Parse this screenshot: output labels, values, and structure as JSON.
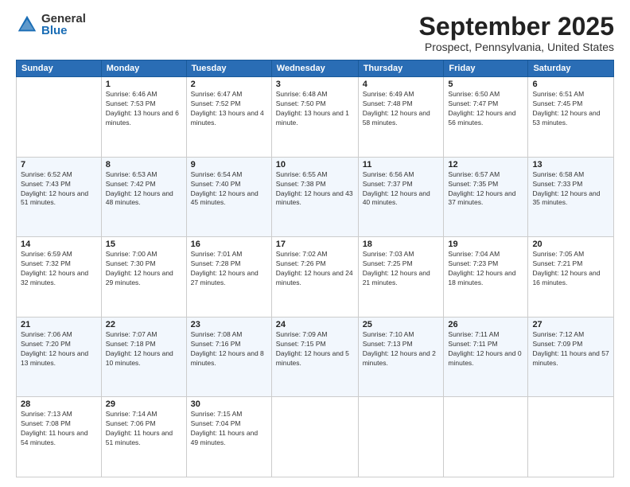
{
  "logo": {
    "general": "General",
    "blue": "Blue"
  },
  "title": "September 2025",
  "subtitle": "Prospect, Pennsylvania, United States",
  "days_header": [
    "Sunday",
    "Monday",
    "Tuesday",
    "Wednesday",
    "Thursday",
    "Friday",
    "Saturday"
  ],
  "weeks": [
    [
      {
        "day": "",
        "sunrise": "",
        "sunset": "",
        "daylight": ""
      },
      {
        "day": "1",
        "sunrise": "Sunrise: 6:46 AM",
        "sunset": "Sunset: 7:53 PM",
        "daylight": "Daylight: 13 hours and 6 minutes."
      },
      {
        "day": "2",
        "sunrise": "Sunrise: 6:47 AM",
        "sunset": "Sunset: 7:52 PM",
        "daylight": "Daylight: 13 hours and 4 minutes."
      },
      {
        "day": "3",
        "sunrise": "Sunrise: 6:48 AM",
        "sunset": "Sunset: 7:50 PM",
        "daylight": "Daylight: 13 hours and 1 minute."
      },
      {
        "day": "4",
        "sunrise": "Sunrise: 6:49 AM",
        "sunset": "Sunset: 7:48 PM",
        "daylight": "Daylight: 12 hours and 58 minutes."
      },
      {
        "day": "5",
        "sunrise": "Sunrise: 6:50 AM",
        "sunset": "Sunset: 7:47 PM",
        "daylight": "Daylight: 12 hours and 56 minutes."
      },
      {
        "day": "6",
        "sunrise": "Sunrise: 6:51 AM",
        "sunset": "Sunset: 7:45 PM",
        "daylight": "Daylight: 12 hours and 53 minutes."
      }
    ],
    [
      {
        "day": "7",
        "sunrise": "Sunrise: 6:52 AM",
        "sunset": "Sunset: 7:43 PM",
        "daylight": "Daylight: 12 hours and 51 minutes."
      },
      {
        "day": "8",
        "sunrise": "Sunrise: 6:53 AM",
        "sunset": "Sunset: 7:42 PM",
        "daylight": "Daylight: 12 hours and 48 minutes."
      },
      {
        "day": "9",
        "sunrise": "Sunrise: 6:54 AM",
        "sunset": "Sunset: 7:40 PM",
        "daylight": "Daylight: 12 hours and 45 minutes."
      },
      {
        "day": "10",
        "sunrise": "Sunrise: 6:55 AM",
        "sunset": "Sunset: 7:38 PM",
        "daylight": "Daylight: 12 hours and 43 minutes."
      },
      {
        "day": "11",
        "sunrise": "Sunrise: 6:56 AM",
        "sunset": "Sunset: 7:37 PM",
        "daylight": "Daylight: 12 hours and 40 minutes."
      },
      {
        "day": "12",
        "sunrise": "Sunrise: 6:57 AM",
        "sunset": "Sunset: 7:35 PM",
        "daylight": "Daylight: 12 hours and 37 minutes."
      },
      {
        "day": "13",
        "sunrise": "Sunrise: 6:58 AM",
        "sunset": "Sunset: 7:33 PM",
        "daylight": "Daylight: 12 hours and 35 minutes."
      }
    ],
    [
      {
        "day": "14",
        "sunrise": "Sunrise: 6:59 AM",
        "sunset": "Sunset: 7:32 PM",
        "daylight": "Daylight: 12 hours and 32 minutes."
      },
      {
        "day": "15",
        "sunrise": "Sunrise: 7:00 AM",
        "sunset": "Sunset: 7:30 PM",
        "daylight": "Daylight: 12 hours and 29 minutes."
      },
      {
        "day": "16",
        "sunrise": "Sunrise: 7:01 AM",
        "sunset": "Sunset: 7:28 PM",
        "daylight": "Daylight: 12 hours and 27 minutes."
      },
      {
        "day": "17",
        "sunrise": "Sunrise: 7:02 AM",
        "sunset": "Sunset: 7:26 PM",
        "daylight": "Daylight: 12 hours and 24 minutes."
      },
      {
        "day": "18",
        "sunrise": "Sunrise: 7:03 AM",
        "sunset": "Sunset: 7:25 PM",
        "daylight": "Daylight: 12 hours and 21 minutes."
      },
      {
        "day": "19",
        "sunrise": "Sunrise: 7:04 AM",
        "sunset": "Sunset: 7:23 PM",
        "daylight": "Daylight: 12 hours and 18 minutes."
      },
      {
        "day": "20",
        "sunrise": "Sunrise: 7:05 AM",
        "sunset": "Sunset: 7:21 PM",
        "daylight": "Daylight: 12 hours and 16 minutes."
      }
    ],
    [
      {
        "day": "21",
        "sunrise": "Sunrise: 7:06 AM",
        "sunset": "Sunset: 7:20 PM",
        "daylight": "Daylight: 12 hours and 13 minutes."
      },
      {
        "day": "22",
        "sunrise": "Sunrise: 7:07 AM",
        "sunset": "Sunset: 7:18 PM",
        "daylight": "Daylight: 12 hours and 10 minutes."
      },
      {
        "day": "23",
        "sunrise": "Sunrise: 7:08 AM",
        "sunset": "Sunset: 7:16 PM",
        "daylight": "Daylight: 12 hours and 8 minutes."
      },
      {
        "day": "24",
        "sunrise": "Sunrise: 7:09 AM",
        "sunset": "Sunset: 7:15 PM",
        "daylight": "Daylight: 12 hours and 5 minutes."
      },
      {
        "day": "25",
        "sunrise": "Sunrise: 7:10 AM",
        "sunset": "Sunset: 7:13 PM",
        "daylight": "Daylight: 12 hours and 2 minutes."
      },
      {
        "day": "26",
        "sunrise": "Sunrise: 7:11 AM",
        "sunset": "Sunset: 7:11 PM",
        "daylight": "Daylight: 12 hours and 0 minutes."
      },
      {
        "day": "27",
        "sunrise": "Sunrise: 7:12 AM",
        "sunset": "Sunset: 7:09 PM",
        "daylight": "Daylight: 11 hours and 57 minutes."
      }
    ],
    [
      {
        "day": "28",
        "sunrise": "Sunrise: 7:13 AM",
        "sunset": "Sunset: 7:08 PM",
        "daylight": "Daylight: 11 hours and 54 minutes."
      },
      {
        "day": "29",
        "sunrise": "Sunrise: 7:14 AM",
        "sunset": "Sunset: 7:06 PM",
        "daylight": "Daylight: 11 hours and 51 minutes."
      },
      {
        "day": "30",
        "sunrise": "Sunrise: 7:15 AM",
        "sunset": "Sunset: 7:04 PM",
        "daylight": "Daylight: 11 hours and 49 minutes."
      },
      {
        "day": "",
        "sunrise": "",
        "sunset": "",
        "daylight": ""
      },
      {
        "day": "",
        "sunrise": "",
        "sunset": "",
        "daylight": ""
      },
      {
        "day": "",
        "sunrise": "",
        "sunset": "",
        "daylight": ""
      },
      {
        "day": "",
        "sunrise": "",
        "sunset": "",
        "daylight": ""
      }
    ]
  ]
}
